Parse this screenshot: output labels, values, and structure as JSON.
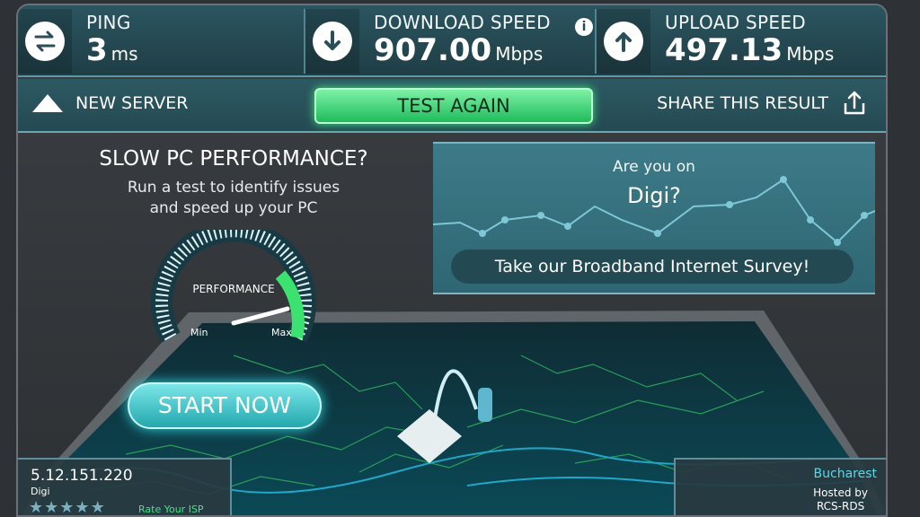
{
  "stats": {
    "ping": {
      "label": "PING",
      "value": "3",
      "unit": "ms"
    },
    "download": {
      "label": "DOWNLOAD SPEED",
      "value": "907.00",
      "unit": "Mbps"
    },
    "upload": {
      "label": "UPLOAD SPEED",
      "value": "497.13",
      "unit": "Mbps"
    },
    "info_glyph": "i"
  },
  "actions": {
    "new_server": "NEW SERVER",
    "test_again": "TEST AGAIN",
    "share": "SHARE THIS RESULT"
  },
  "promo": {
    "title": "SLOW PC PERFORMANCE?",
    "line1": "Run a test to identify issues",
    "line2": "and speed up your PC",
    "gauge_label": "PERFORMANCE",
    "gauge_min": "Min",
    "gauge_max": "Max",
    "start_now": "START NOW"
  },
  "survey": {
    "line1": "Are you on",
    "line2": "Digi?",
    "cta": "Take our Broadband Internet Survey!"
  },
  "client": {
    "ip": "5.12.151.220",
    "isp": "Digi",
    "rating_stars": 0,
    "rating_max": 5,
    "rate_label": "Rate Your ISP"
  },
  "server": {
    "city": "Bucharest",
    "hosted_label": "Hosted by",
    "host": "RCS-RDS"
  },
  "colors": {
    "accent_green": "#20bb5b",
    "accent_cyan": "#2fd6dd",
    "panel_teal": "#2b5560"
  }
}
